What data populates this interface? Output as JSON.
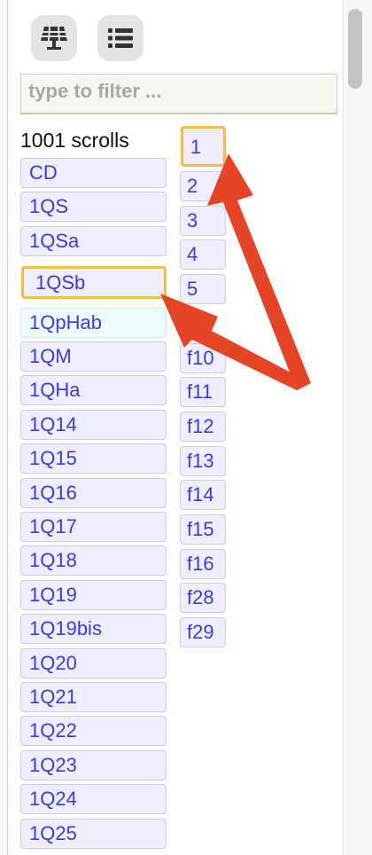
{
  "toolbar": {
    "grid_icon": "solar-panel-grid-icon",
    "list_icon": "list-icon"
  },
  "filter": {
    "placeholder": "type to filter ..."
  },
  "scroll_count": "1001 scrolls",
  "scrolls": [
    "CD",
    "1QS",
    "1QSa",
    "1QSb",
    "1QpHab",
    "1QM",
    "1QHa",
    "1Q14",
    "1Q15",
    "1Q16",
    "1Q17",
    "1Q18",
    "1Q19",
    "1Q19bis",
    "1Q20",
    "1Q21",
    "1Q22",
    "1Q23",
    "1Q24",
    "1Q25"
  ],
  "selected_scroll": "1QpHab",
  "highlighted_scroll": "1QSb",
  "fragments": [
    "1",
    "2",
    "3",
    "4",
    "5",
    "f10",
    "f11",
    "f12",
    "f13",
    "f14",
    "f15",
    "f16",
    "f28",
    "f29"
  ],
  "highlighted_fragment": "1",
  "colors": {
    "highlight": "#f7bc47",
    "arrow": "#e64427",
    "link": "#3c3ce0"
  }
}
